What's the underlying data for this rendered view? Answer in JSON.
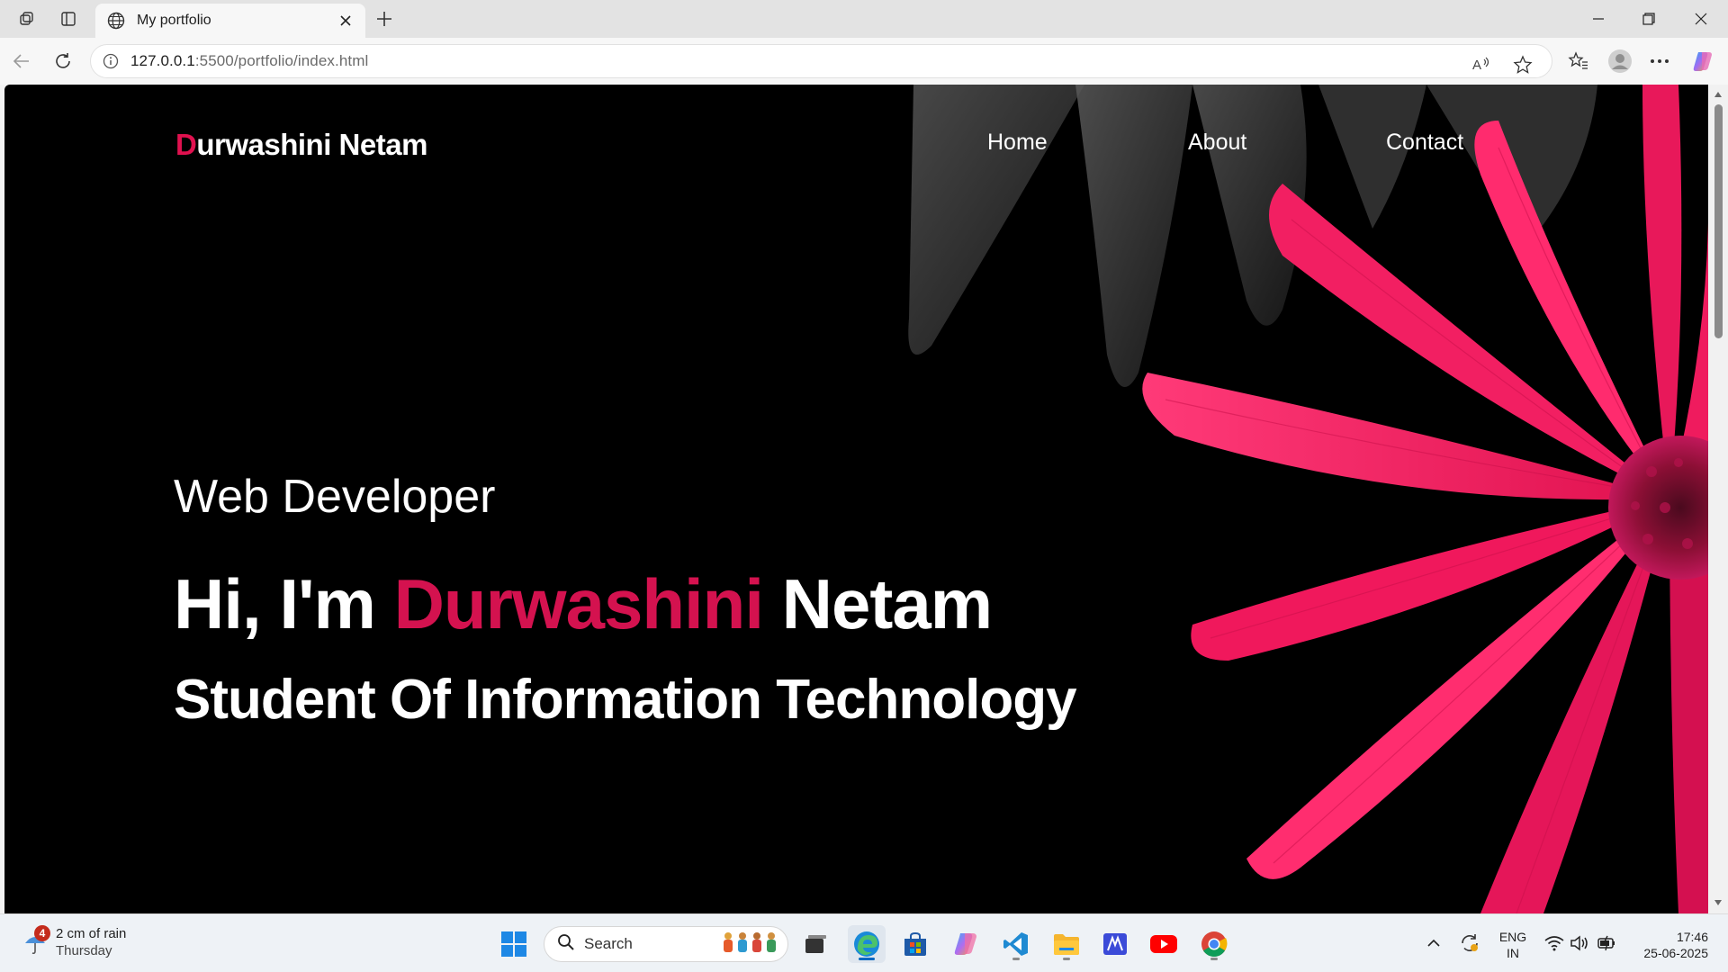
{
  "browser": {
    "tab_title": "My portfolio",
    "url_host": "127.0.0.1",
    "url_path": ":5500/portfolio/index.html"
  },
  "page": {
    "brand_initial": "D",
    "brand_rest": "urwashini Netam",
    "nav": [
      {
        "label": "Home"
      },
      {
        "label": "About"
      },
      {
        "label": "Contact"
      }
    ],
    "hero_subtitle": "Web Developer",
    "hero_greeting": "Hi, I'm ",
    "hero_name_first": "Durwashini",
    "hero_name_last": " Netam",
    "hero_role": "Student Of Information Technology",
    "colors": {
      "accent": "#e0114f",
      "background": "#000000"
    }
  },
  "taskbar": {
    "weather_badge": "4",
    "weather_line1": "2 cm of rain",
    "weather_line2": "Thursday",
    "search_label": "Search",
    "lang_line1": "ENG",
    "lang_line2": "IN",
    "time": "17:46",
    "date": "25-06-2025",
    "apps": [
      "file-explorer-icon",
      "edge-icon",
      "store-icon",
      "copilot-icon",
      "vscode-icon",
      "folder-icon",
      "sway-icon",
      "youtube-icon",
      "chrome-icon"
    ]
  }
}
